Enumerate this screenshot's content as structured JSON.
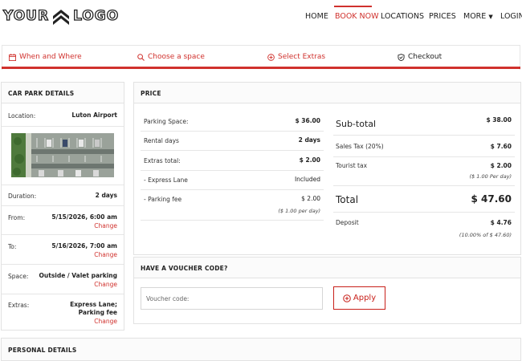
{
  "brand": {
    "logo_left": "YOUR",
    "logo_right": "LOGO",
    "accent": "#d0312d"
  },
  "nav": {
    "items": [
      {
        "label": "HOME"
      },
      {
        "label": "BOOK NOW"
      },
      {
        "label": "LOCATIONS"
      },
      {
        "label": "PRICES"
      },
      {
        "label": "MORE"
      },
      {
        "label": "LOGIN"
      }
    ],
    "active": "BOOK NOW"
  },
  "steps": [
    {
      "label": "When and Where",
      "icon": "calendar-icon"
    },
    {
      "label": "Choose a space",
      "icon": "search-icon"
    },
    {
      "label": "Select Extras",
      "icon": "plus-circle-icon"
    },
    {
      "label": "Checkout",
      "icon": "shield-check-icon"
    }
  ],
  "car_park": {
    "title": "CAR PARK DETAILS",
    "location_label": "Location:",
    "location": "Luton Airport",
    "duration_label": "Duration:",
    "duration": "2 days",
    "from_label": "From:",
    "from": "5/15/2026, 6:00 am",
    "to_label": "To:",
    "to": "5/16/2026, 7:00 am",
    "space_label": "Space:",
    "space": "Outside / Valet parking",
    "extras_label": "Extras:",
    "extras": "Express Lane; Parking fee",
    "change": "Change"
  },
  "price": {
    "title": "PRICE",
    "parking_space_label": "Parking Space:",
    "parking_space": "$ 36.00",
    "rental_days_label": "Rental days",
    "rental_days": "2 days",
    "extras_total_label": "Extras total:",
    "extras_total": "$ 2.00",
    "express_lane_label": "- Express Lane",
    "express_lane": "Included",
    "parking_fee_label": "- Parking fee",
    "parking_fee": "$ 2.00",
    "parking_fee_note": "($ 1.00 per day)",
    "subtotal_label": "Sub-total",
    "subtotal": "$ 38.00",
    "sales_tax_label": "Sales Tax (20%)",
    "sales_tax": "$ 7.60",
    "tourist_tax_label": "Tourist tax",
    "tourist_tax": "$ 2.00",
    "tourist_tax_note": "($ 1.00 Per day)",
    "total_label": "Total",
    "total": "$ 47.60",
    "deposit_label": "Deposit",
    "deposit": "$ 4.76",
    "deposit_note": "(10.00% of $ 47.60)"
  },
  "voucher": {
    "title": "HAVE A VOUCHER CODE?",
    "placeholder": "Voucher code:",
    "apply_label": "Apply"
  },
  "personal": {
    "title": "PERSONAL DETAILS"
  }
}
